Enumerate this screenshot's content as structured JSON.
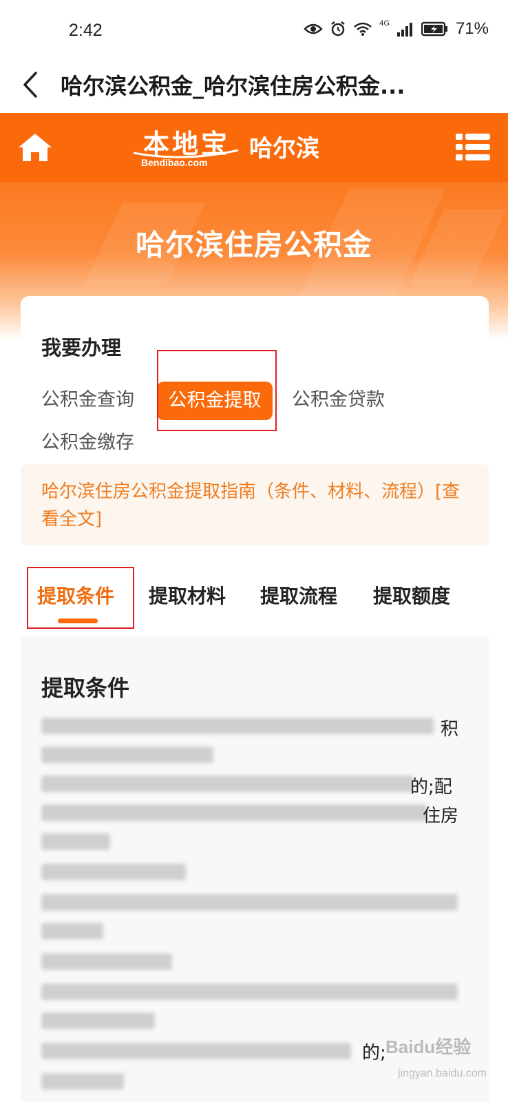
{
  "status_bar": {
    "time": "2:42",
    "network": "4G",
    "battery": "71%"
  },
  "title_bar": {
    "title": "哈尔滨公积金_哈尔滨住房公积金..."
  },
  "header": {
    "logo_main": "本地宝",
    "logo_sub": "Bendibao.com",
    "city": "哈尔滨",
    "bg_color": "#fb6a0a"
  },
  "banner": {
    "title": "哈尔滨住房公积金"
  },
  "services": {
    "heading": "我要办理",
    "options": [
      "公积金查询",
      "公积金提取",
      "公积金贷款",
      "公积金缴存"
    ],
    "active_index": 1
  },
  "guide": {
    "text": "哈尔滨住房公积金提取指南（条件、材料、流程）[查看全文]"
  },
  "tabs": [
    "提取条件",
    "提取材料",
    "提取流程",
    "提取额度"
  ],
  "content": {
    "heading": "提取条件",
    "visible_fragments": [
      "积",
      "的;配",
      "住房",
      "的;"
    ]
  },
  "watermark": {
    "main": "Baidu经验",
    "sub": "jingyan.baidu.com"
  },
  "colors": {
    "accent": "#fb6a0a",
    "guide_text": "#ef7d22",
    "highlight_border": "#e02020"
  }
}
